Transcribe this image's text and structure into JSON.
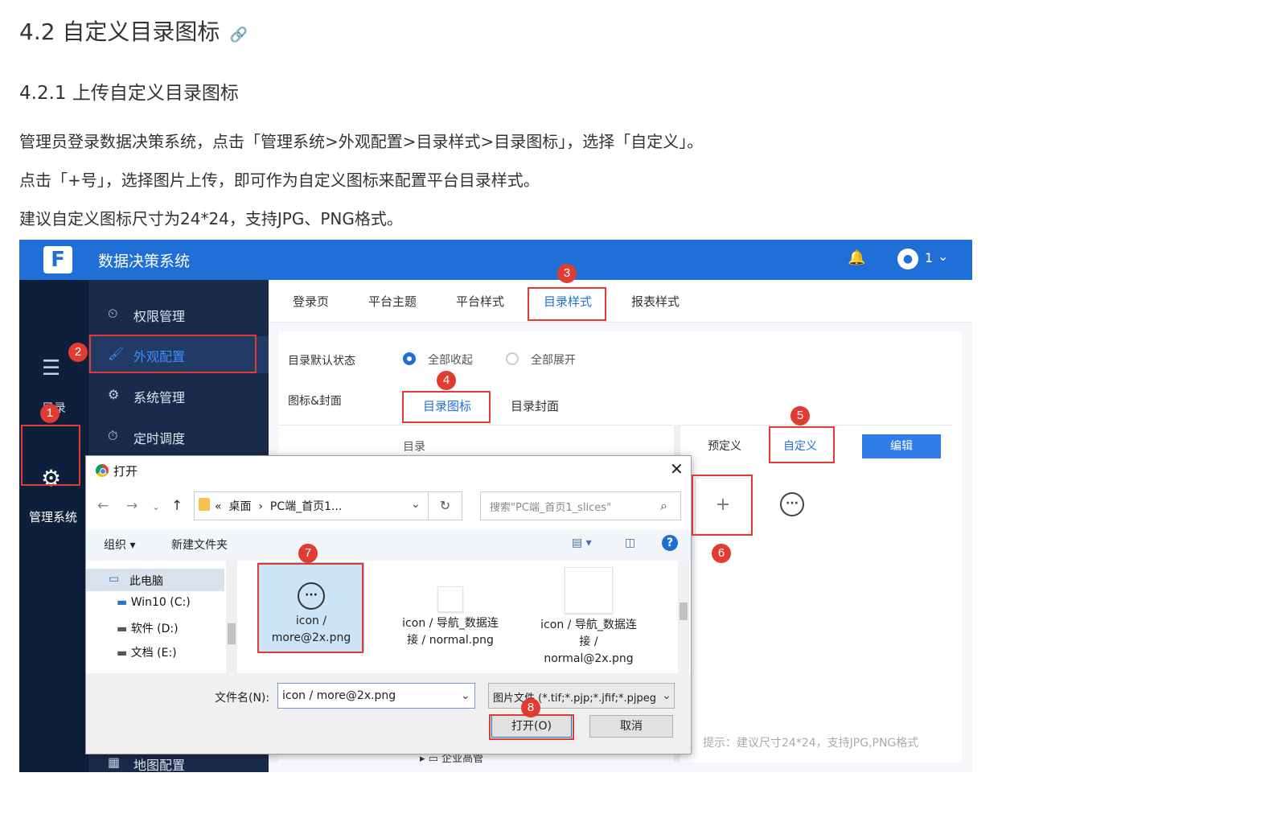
{
  "doc": {
    "h2": "4.2 自定义目录图标",
    "h3": "4.2.1 上传自定义目录图标",
    "p1": "管理员登录数据决策系统，点击「管理系统>外观配置>目录样式>目录图标」，选择「自定义」。",
    "p2": "点击「+号」，选择图片上传，即可作为自定义图标来配置平台目录样式。",
    "p3": "建议自定义图标尺寸为24*24，支持JPG、PNG格式。"
  },
  "app": {
    "title": "数据决策系统",
    "user": "1",
    "rail": {
      "dir_label": "目录",
      "admin_label": "管理系统"
    },
    "menu": [
      {
        "label": "权限管理",
        "icon": "clock-shield-icon"
      },
      {
        "label": "外观配置",
        "icon": "paint-roller-icon"
      },
      {
        "label": "系统管理",
        "icon": "gear-icon"
      },
      {
        "label": "定时调度",
        "icon": "timer-icon"
      },
      {
        "label": "地图配置",
        "icon": "map-icon"
      }
    ],
    "tabs": [
      "登录页",
      "平台主题",
      "平台样式",
      "目录样式",
      "报表样式"
    ],
    "active_tab": "目录样式",
    "default_state_label": "目录默认状态",
    "radio_collapse": "全部收起",
    "radio_expand": "全部展开",
    "icon_cover_label": "图标&封面",
    "sub_tab_icon": "目录图标",
    "sub_tab_cover": "目录封面",
    "tree_head": "目录",
    "tree_item": "企业高管",
    "icon_tab_preset": "预定义",
    "icon_tab_custom": "自定义",
    "edit_button": "编辑",
    "add_symbol": "+",
    "hint": "提示：建议尺寸24*24，支持JPG,PNG格式"
  },
  "dialog": {
    "title": "打开",
    "address_prefix": "«",
    "address_parts": [
      "桌面",
      "PC端_首页1..."
    ],
    "search_placeholder": "搜索\"PC端_首页1_slices\"",
    "organize": "组织 ▾",
    "new_folder": "新建文件夹",
    "nav_items": [
      "此电脑",
      "Win10 (C:)",
      "软件 (D:)",
      "文档 (E:)"
    ],
    "files": [
      {
        "name": "icon / more@2x.png",
        "selected": true
      },
      {
        "name": "icon / 导航_数据连接 / normal.png",
        "selected": false
      },
      {
        "name": "icon / 导航_数据连接 / normal@2x.png",
        "selected": false
      }
    ],
    "filename_label": "文件名(N):",
    "filename_value": "icon / more@2x.png",
    "filetype_value": "图片文件 (*.tif;*.pjp;*.jfif;*.pjpeg",
    "open_button": "打开(O)",
    "cancel_button": "取消"
  },
  "callouts": [
    "1",
    "2",
    "3",
    "4",
    "5",
    "6",
    "7",
    "8"
  ],
  "colors": {
    "brand_blue": "#1f6fd6",
    "callout_red": "#e03c31",
    "sidebar_dark": "#0e1f3c"
  }
}
